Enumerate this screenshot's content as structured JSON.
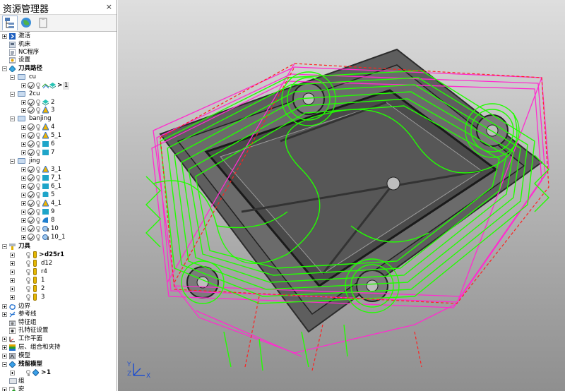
{
  "explorer": {
    "title": "资源管理器",
    "close_symbol": "×"
  },
  "tree": {
    "root": [
      {
        "label": "激活"
      },
      {
        "label": "机床"
      },
      {
        "label": "NC程序"
      },
      {
        "label": "设置"
      },
      {
        "label": "刀具路径"
      },
      {
        "label": "边界"
      },
      {
        "label": "参考线"
      },
      {
        "label": "特征组"
      },
      {
        "label": "孔特征设置"
      },
      {
        "label": "工作平面"
      },
      {
        "label": "层、组合和夹持"
      },
      {
        "label": "模型"
      },
      {
        "label": "残留模型"
      },
      {
        "label": "组"
      },
      {
        "label": "宏"
      }
    ],
    "toolpath_folders": [
      {
        "label": "cu",
        "items": [
          {
            "label": "1",
            "active": true
          }
        ]
      },
      {
        "label": "2cu",
        "items": [
          {
            "label": "2"
          },
          {
            "label": "3"
          }
        ]
      },
      {
        "label": "banjing",
        "items": [
          {
            "label": "4"
          },
          {
            "label": "5_1"
          },
          {
            "label": "6"
          },
          {
            "label": "7"
          }
        ]
      },
      {
        "label": "jing",
        "items": [
          {
            "label": "3_1"
          },
          {
            "label": "7_1"
          },
          {
            "label": "6_1"
          },
          {
            "label": "5"
          },
          {
            "label": "4_1"
          },
          {
            "label": "9"
          },
          {
            "label": "8"
          },
          {
            "label": "10"
          },
          {
            "label": "10_1"
          }
        ]
      }
    ],
    "tools": {
      "label": "刀具",
      "items": [
        {
          "label": "d25r1",
          "active": true
        },
        {
          "label": "d12"
        },
        {
          "label": "r4"
        },
        {
          "label": "1"
        },
        {
          "label": "2"
        },
        {
          "label": "3"
        }
      ]
    },
    "stock_models": [
      {
        "label": "1",
        "active": true
      }
    ]
  },
  "viewport": {
    "axis_labels": {
      "x": "X",
      "y": "Y",
      "z": "Z"
    },
    "colors": {
      "toolpath": "#22ff00",
      "rapid": "#ff2ccf",
      "feed_lead": "#ff2020",
      "part": "#5b5b5b"
    }
  }
}
